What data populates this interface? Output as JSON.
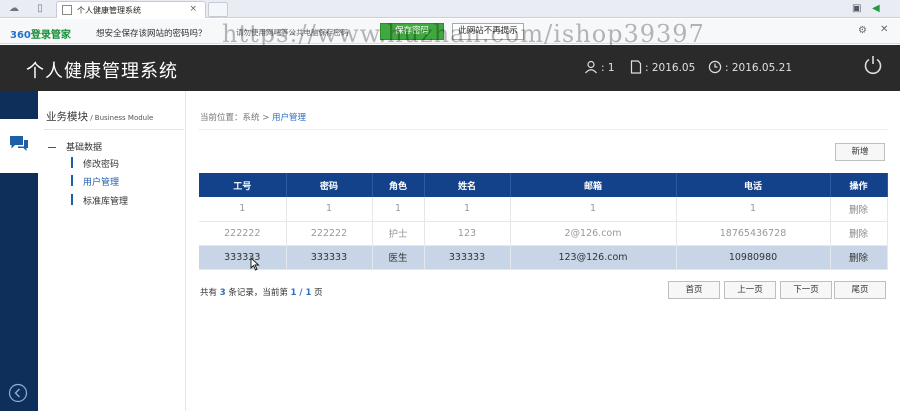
{
  "browser": {
    "tab_title": "个人健康管理系统",
    "tab_close": "×"
  },
  "password_bar": {
    "brand_num": "360",
    "brand_text": "登录管家",
    "message": "想安全保存该网站的密码吗？",
    "sub": "请勿使用网吧等公共电脑保存密码",
    "save_label": "保存密码",
    "no_label": "此网站不再提示"
  },
  "watermark": "https://www.huzhan.com/ishop39397",
  "header": {
    "title": "个人健康管理系统",
    "user": ": 1",
    "doc": ": 2016.05",
    "time": ": 2016.05.21"
  },
  "sidebar": {
    "title": "业务模块",
    "title_sub": " / Business Module",
    "group": "基础数据",
    "items": [
      "修改密码",
      "用户管理",
      "标准库管理"
    ]
  },
  "breadcrumb": {
    "prefix": "当前位置：系统 > ",
    "current": "用户管理"
  },
  "toolbar": {
    "add_label": "新增"
  },
  "table": {
    "headers": [
      "工号",
      "密码",
      "角色",
      "姓名",
      "邮箱",
      "电话",
      "操作"
    ],
    "rows": [
      [
        "1",
        "1",
        "1",
        "1",
        "1",
        "1",
        "删除"
      ],
      [
        "222222",
        "222222",
        "护士",
        "123",
        "2@126.com",
        "18765436728",
        "删除"
      ],
      [
        "333333",
        "333333",
        "医生",
        "333333",
        "123@126.com",
        "10980980",
        "删除"
      ]
    ]
  },
  "pagination": {
    "text_a": "共有 ",
    "total": "3",
    "text_b": " 条记录，当前第 ",
    "page": "1 / 1",
    "text_c": " 页",
    "first": "首页",
    "prev": "上一页",
    "next": "下一页",
    "last": "尾页"
  },
  "colors": {
    "header_bg": "#2a2a2a",
    "rail_bg": "#0e2f5a",
    "table_head": "#14428a",
    "selected_row": "#c7d5e6",
    "accent": "#2e70c0"
  }
}
